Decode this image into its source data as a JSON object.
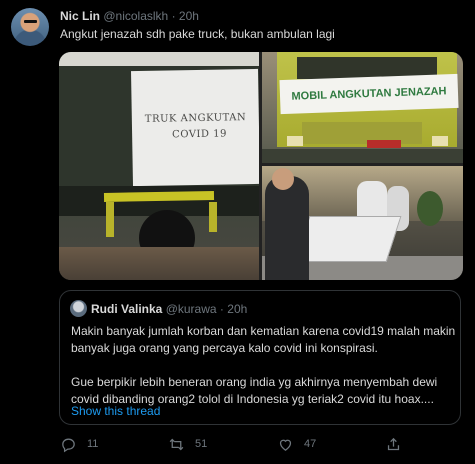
{
  "tweet": {
    "author_name": "Nic Lin",
    "author_handle": "@nicolaslkh",
    "separator": "·",
    "time": "20h",
    "text": "Angkut jenazah sdh pake truck, bukan ambulan lagi"
  },
  "media": {
    "photo1_banner_line1": "TRUK ANGKUTAN",
    "photo1_banner_line2": "COVID 19",
    "photo2_banner": "MOBIL ANGKUTAN JENAZAH"
  },
  "quoted_tweet": {
    "author_name": "Rudi Valinka",
    "author_handle": "@kurawa",
    "separator": "·",
    "time": "20h",
    "paragraph1": "Makin banyak jumlah korban dan kematian karena covid19 malah makin banyak juga orang yang percaya kalo covid ini konspirasi.",
    "paragraph2": "Gue berpikir lebih beneran orang india yg akhirnya menyembah dewi covid dibanding orang2 tolol di Indonesia yg teriak2 covid itu hoax....",
    "show_thread": "Show this thread"
  },
  "actions": {
    "reply_count": "11",
    "retweet_count": "51",
    "like_count": "47"
  },
  "icons": {
    "reply": "reply-icon",
    "retweet": "retweet-icon",
    "like": "heart-icon",
    "share": "share-icon"
  },
  "colors": {
    "background": "#000000",
    "text": "#d9d9d9",
    "muted": "#6e767d",
    "link": "#1d9bf0",
    "border": "#2f3336"
  }
}
